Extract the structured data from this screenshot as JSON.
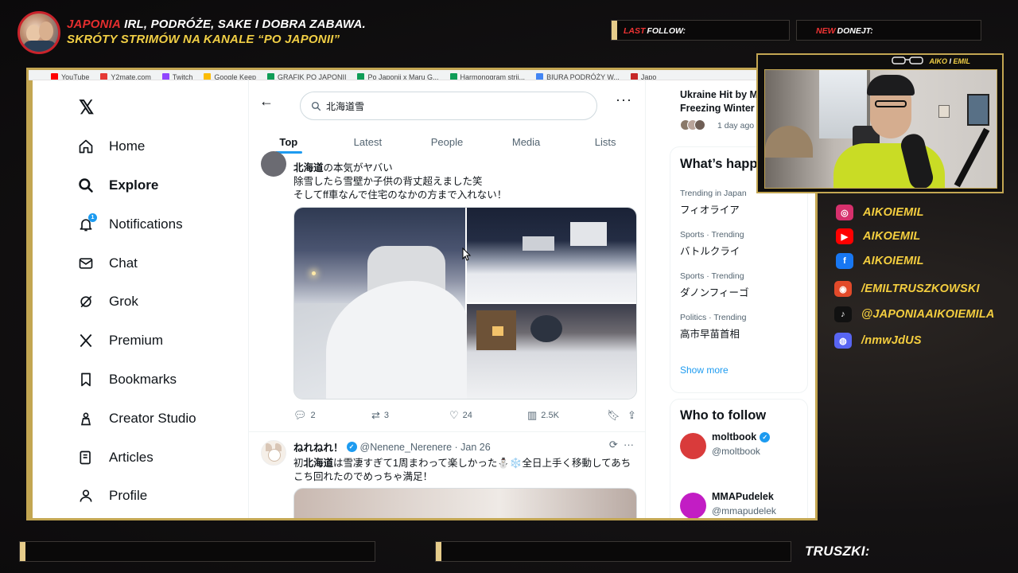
{
  "overlay": {
    "header_accent": "JAPONIA",
    "header_line1_rest": "IRL, PODRÓŻE, SAKE I DOBRA ZABAWA.",
    "header_line2": "SKRÓTY STRIMÓW NA KANALE “PO JAPONII”",
    "last_follow_prefix": "LAST",
    "last_follow_label": "FOLLOW:",
    "new_donejt_prefix": "NEW",
    "new_donejt_label": "DONEJT:",
    "cam_tag_left": "AIKO",
    "cam_tag_mid": "I",
    "cam_tag_right": "EMIL",
    "truszki": "TRUSZKI:",
    "colors": {
      "accent_red": "#e52e2e",
      "accent_yellow": "#f1cf45",
      "frame_gold": "#c3a652"
    }
  },
  "socials": [
    {
      "icon": "instagram-icon",
      "glyph": "◎",
      "color": "#d6306c",
      "label": "AIKOIEMIL"
    },
    {
      "icon": "youtube-icon",
      "glyph": "▶",
      "color": "#ff0000",
      "label": "AIKOEMIL"
    },
    {
      "icon": "facebook-icon",
      "glyph": "f",
      "color": "#1877f2",
      "label": "AIKOIEMIL"
    },
    {
      "icon": "patronite-icon",
      "glyph": "◉",
      "color": "#e24a2a",
      "label": "/EMILTRUSZKOWSKI"
    },
    {
      "icon": "tiktok-icon",
      "glyph": "♪",
      "color": "#111111",
      "label": "@JAPONIAAIKOIEMILA"
    },
    {
      "icon": "discord-icon",
      "glyph": "◍",
      "color": "#5865f2",
      "label": "/nmwJdUS"
    }
  ],
  "browser": {
    "bookmarks": [
      {
        "label": "YouTube",
        "color": "#ff0000"
      },
      {
        "label": "Y2mate.com",
        "color": "#e53935"
      },
      {
        "label": "Twitch",
        "color": "#9146ff"
      },
      {
        "label": "Google Keep",
        "color": "#fbbc04"
      },
      {
        "label": "GRAFIK PO JAPONII",
        "color": "#0f9d58"
      },
      {
        "label": "Po Japonii x Maru G...",
        "color": "#0f9d58"
      },
      {
        "label": "Harmonogram strii...",
        "color": "#0f9d58"
      },
      {
        "label": "BIURA PODRÓŻY W...",
        "color": "#4285f4"
      },
      {
        "label": "Japo",
        "color": "#c62828"
      }
    ]
  },
  "x_app": {
    "nav": [
      {
        "name": "home",
        "label": "Home",
        "icon": "home-icon"
      },
      {
        "name": "explore",
        "label": "Explore",
        "icon": "search-icon",
        "active": true
      },
      {
        "name": "notifications",
        "label": "Notifications",
        "icon": "bell-icon",
        "badge": "1"
      },
      {
        "name": "chat",
        "label": "Chat",
        "icon": "mail-icon"
      },
      {
        "name": "grok",
        "label": "Grok",
        "icon": "grok-icon"
      },
      {
        "name": "premium",
        "label": "Premium",
        "icon": "x-premium-icon"
      },
      {
        "name": "bookmarks",
        "label": "Bookmarks",
        "icon": "bookmark-icon"
      },
      {
        "name": "creator-studio",
        "label": "Creator Studio",
        "icon": "creator-studio-icon"
      },
      {
        "name": "articles",
        "label": "Articles",
        "icon": "articles-icon"
      },
      {
        "name": "profile",
        "label": "Profile",
        "icon": "person-icon"
      }
    ],
    "search": {
      "query": "北海道雪"
    },
    "tabs": [
      "Top",
      "Latest",
      "People",
      "Media",
      "Lists"
    ],
    "active_tab": "Top",
    "tweet1": {
      "line1_bold": "北海道",
      "line1_rest": "の本気がヤバい",
      "line2": "除雪したら雪壁か子供の背丈超えました笑",
      "line3": "そしてff車なんで住宅のなかの方まで入れない！",
      "replies": "2",
      "reposts": "3",
      "likes": "24",
      "views": "2.5K"
    },
    "tweet2": {
      "name": "ねれねれ！",
      "handle": "@Nenene_Nerenere",
      "date": "· Jan 26",
      "text_pre": "初",
      "text_bold": "北海道",
      "text_post": "は雪凄すぎて1周まわって楽しかった⛄❄️全日上手く移動してあち",
      "text_line2": "こち回れたのでめっちゃ満足！"
    },
    "sidebar": {
      "news_title_1": "Ukraine Hit by Ma",
      "news_title_2": "Freezing Winter",
      "news_meta": "1 day ago",
      "whats_happening": "What’s happe",
      "trends": [
        {
          "meta": "Trending in Japan",
          "title": "フィオライア"
        },
        {
          "meta": "Sports · Trending",
          "title": "バトルクライ"
        },
        {
          "meta": "Sports · Trending",
          "title": "ダノンフィーゴ"
        },
        {
          "meta": "Politics · Trending",
          "title": "高市早苗首相"
        }
      ],
      "show_more": "Show more",
      "who_to_follow": "Who to follow",
      "follow": [
        {
          "name": "moltbook",
          "handle": "@moltbook",
          "verified": true,
          "color": "#d93b3b"
        },
        {
          "name": "MMAPudelek",
          "handle": "@mmapudelek",
          "verified": false,
          "color": "#c21dc4"
        }
      ]
    }
  }
}
